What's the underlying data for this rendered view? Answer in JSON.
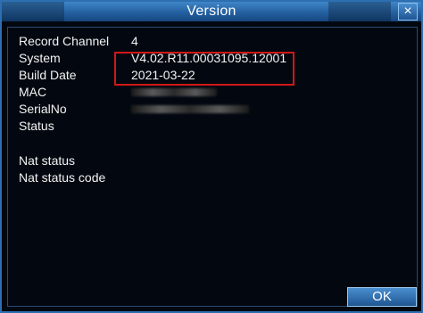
{
  "window": {
    "title": "Version",
    "close_label": "×"
  },
  "fields": [
    {
      "label": "Record Channel",
      "value": "4"
    },
    {
      "label": "System",
      "value": "V4.02.R11.00031095.12001"
    },
    {
      "label": "Build Date",
      "value": "2021-03-22"
    },
    {
      "label": "MAC",
      "value": ""
    },
    {
      "label": "SerialNo",
      "value": ""
    },
    {
      "label": "Status",
      "value": ""
    },
    {
      "label": "Nat status",
      "value": ""
    },
    {
      "label": "Nat status code",
      "value": ""
    }
  ],
  "buttons": {
    "ok_label": "OK"
  },
  "colors": {
    "titlebar": "#2460a0",
    "background": "#030810",
    "highlight": "#d01818",
    "text": "#f2f2f2"
  }
}
